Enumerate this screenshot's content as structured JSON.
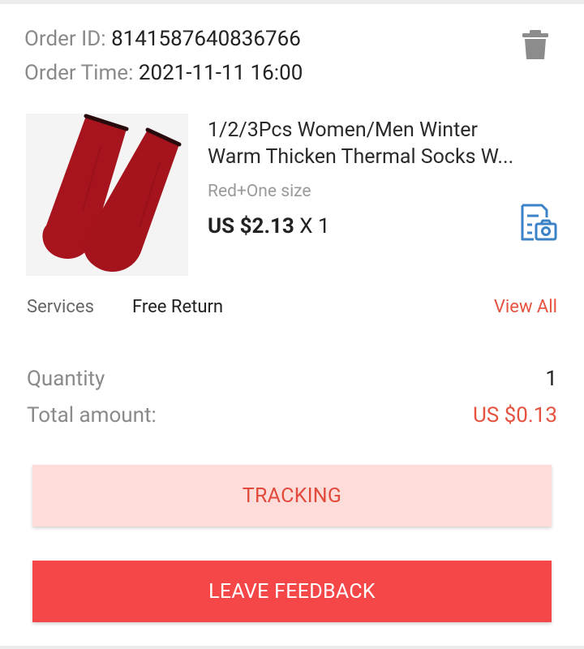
{
  "order": {
    "id_label": "Order ID:",
    "id_value": "8141587640836766",
    "time_label": "Order Time:",
    "time_value": "2021-11-11 16:00"
  },
  "icons": {
    "delete": "trash-icon",
    "photo_review": "document-camera-icon"
  },
  "product": {
    "title_line1": "1/2/3Pcs Women/Men Winter",
    "title_line2": "Warm Thicken Thermal Socks W...",
    "variant": "Red+One size",
    "price": "US $2.13",
    "quantity_text": "X 1",
    "image": "red-thermal-socks"
  },
  "services": {
    "label": "Services",
    "value": "Free Return",
    "link": "View All"
  },
  "summary": {
    "quantity_label": "Quantity",
    "quantity_value": "1",
    "total_label": "Total amount:",
    "total_value": "US $0.13"
  },
  "buttons": {
    "tracking": "TRACKING",
    "feedback": "LEAVE FEEDBACK"
  },
  "colors": {
    "accent": "#e5533f",
    "primary_button": "#f64748",
    "secondary_button": "#fddcd9",
    "icon_blue": "#3b83c6",
    "sock": "#a8141e"
  }
}
